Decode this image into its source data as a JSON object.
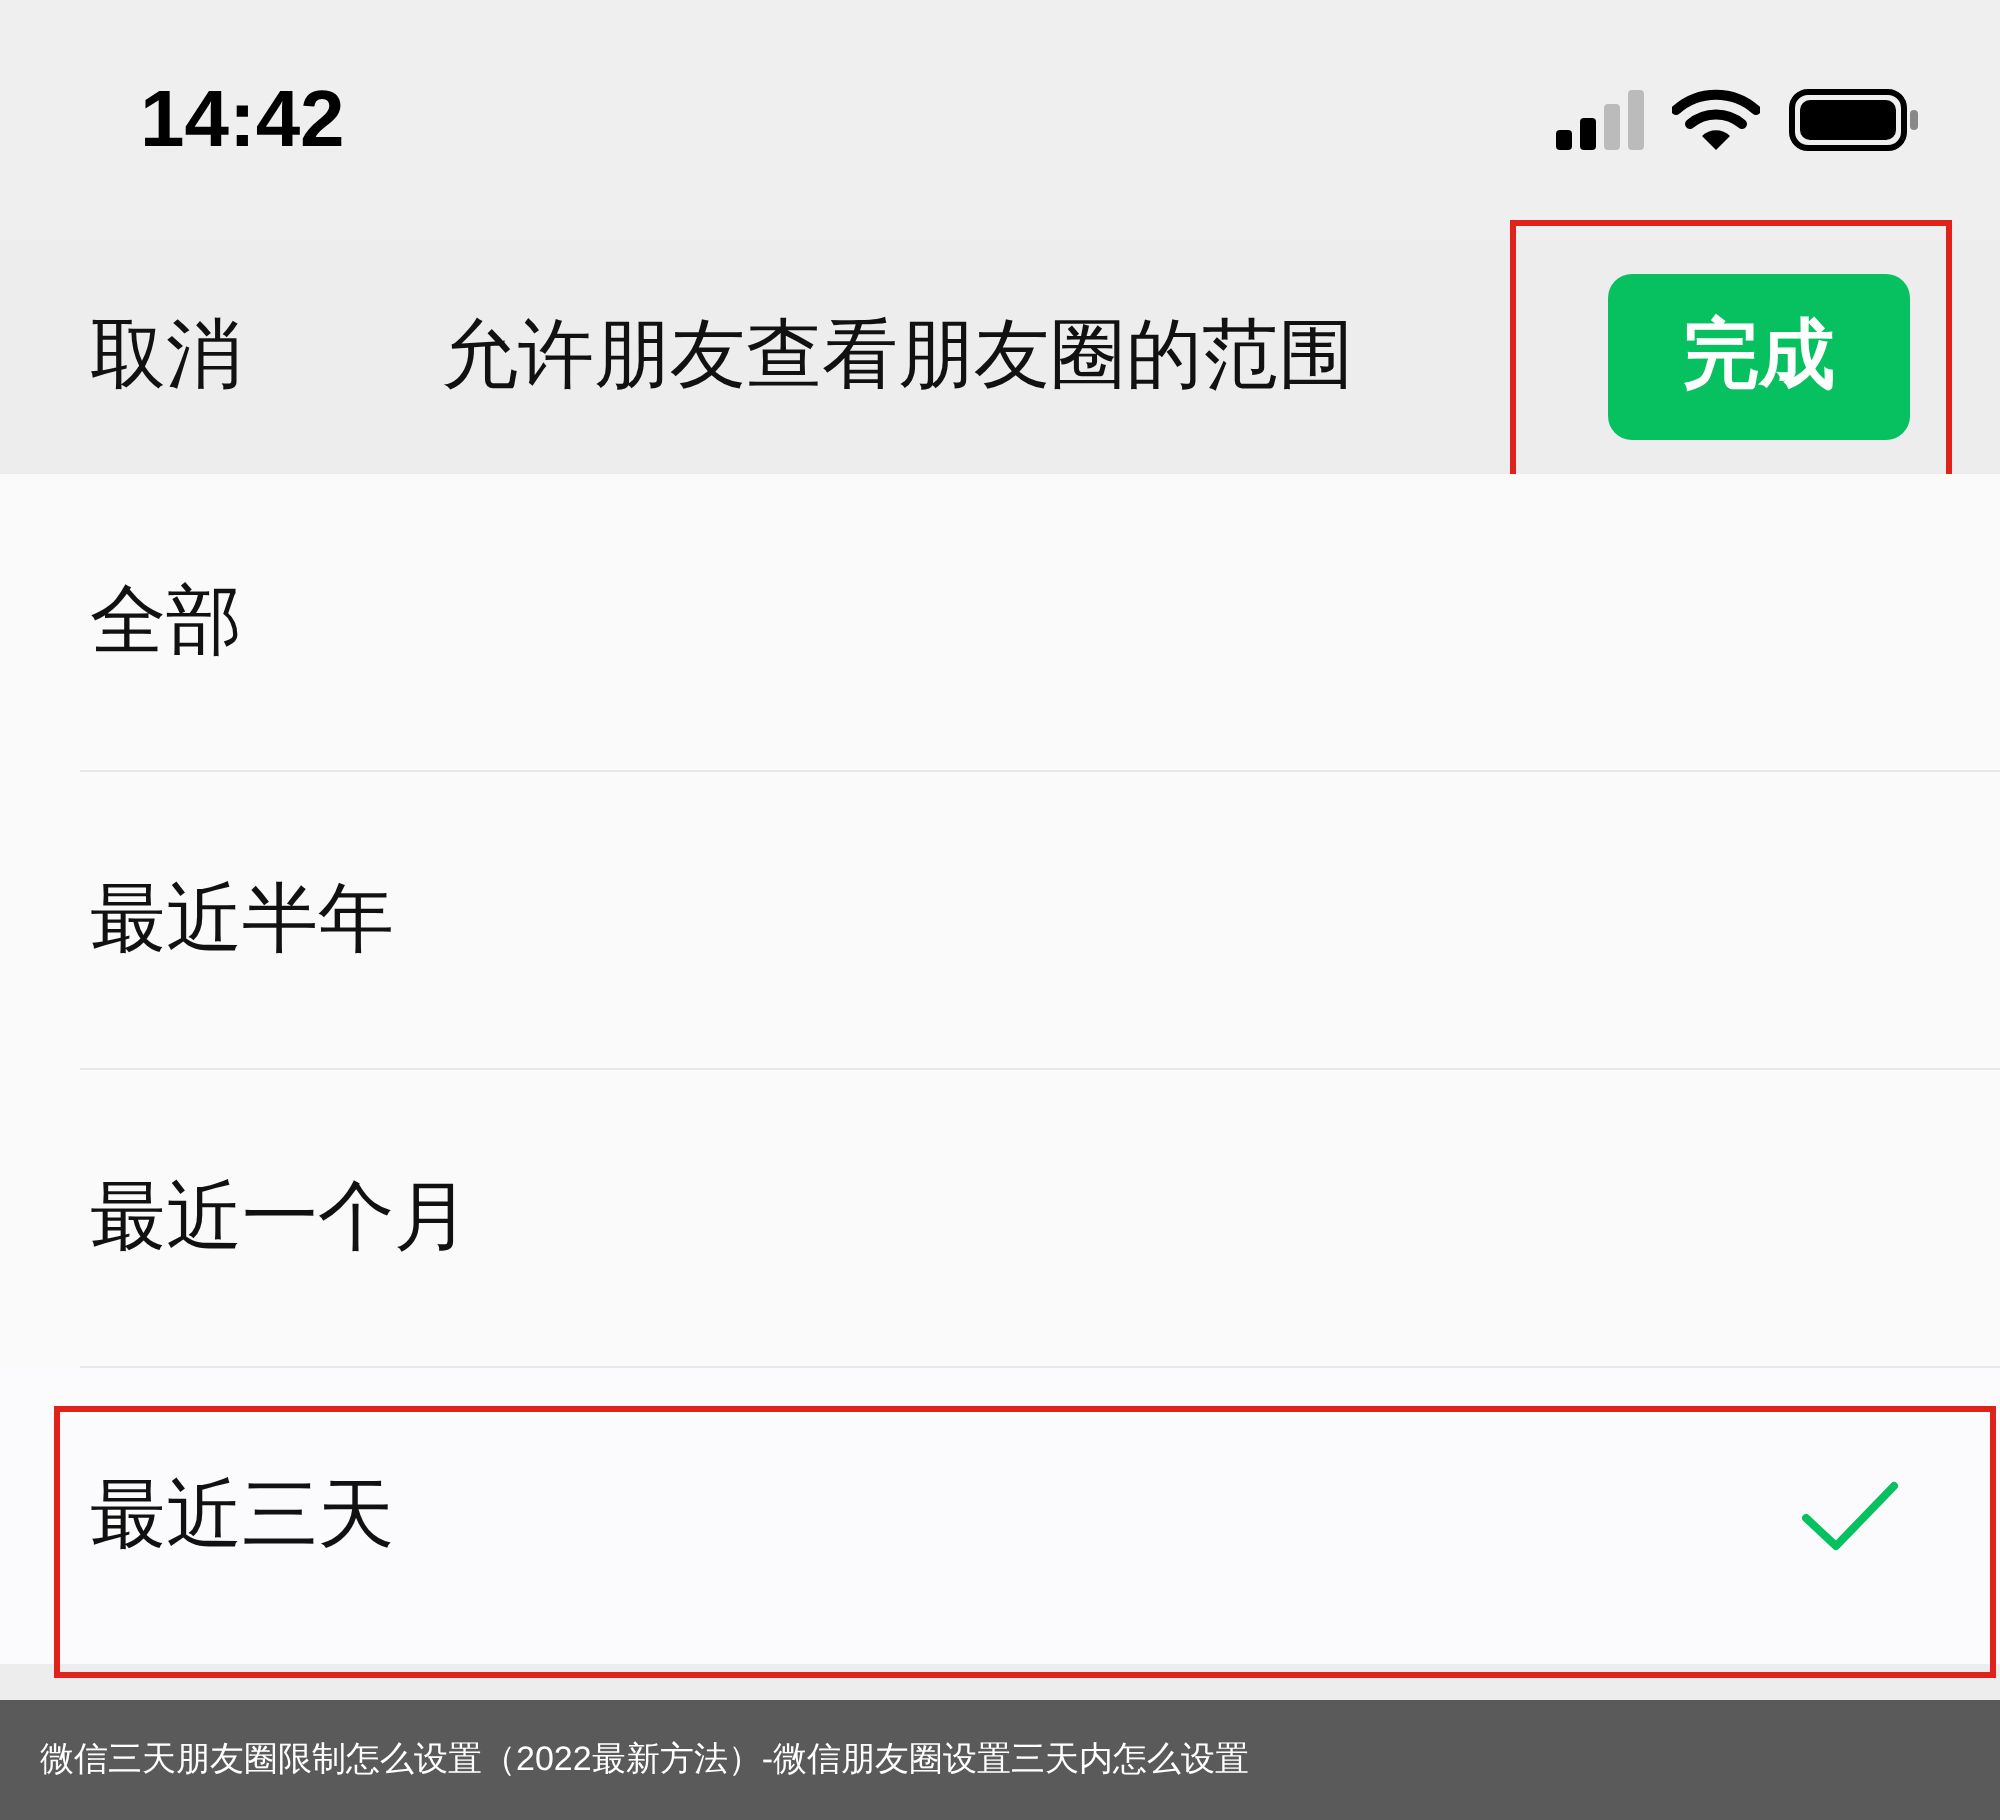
{
  "status_bar": {
    "time": "14:42"
  },
  "nav": {
    "cancel": "取消",
    "title": "允许朋友查看朋友圈的范围",
    "done": {
      "label": "完成",
      "highlighted": true
    }
  },
  "options": [
    {
      "label": "全部",
      "selected": false,
      "highlighted": false
    },
    {
      "label": "最近半年",
      "selected": false,
      "highlighted": false
    },
    {
      "label": "最近一个月",
      "selected": false,
      "highlighted": false
    },
    {
      "label": "最近三天",
      "selected": true,
      "highlighted": true
    }
  ],
  "caption": "微信三天朋友圈限制怎么设置（2022最新方法）-微信朋友圈设置三天内怎么设置"
}
